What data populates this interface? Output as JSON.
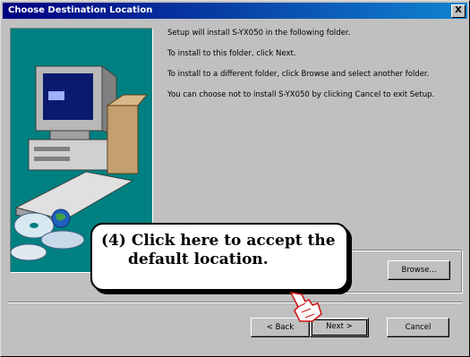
{
  "window": {
    "title": "Choose Destination Location",
    "close_label": "X"
  },
  "content": {
    "line1": "Setup will install S-YX050 in the following folder.",
    "line2": "To install to this folder, click Next.",
    "line3": "To install to a different folder, click Browse and select another folder.",
    "line4": "You can choose not to install S-YX050 by clicking Cancel to exit Setup."
  },
  "buttons": {
    "browse": "Browse...",
    "back": "< Back",
    "next": "Next >",
    "cancel": "Cancel"
  },
  "callout": {
    "number": "(4)",
    "line1": "Click here to accept the",
    "line2": "default location."
  },
  "icons": [
    "computer-illustration-icon",
    "cd-discs-icon",
    "hand-pointer-icon"
  ],
  "colors": {
    "titlebar": "#000080",
    "dialog": "#c0c0c0",
    "art_bg": "#008080"
  }
}
